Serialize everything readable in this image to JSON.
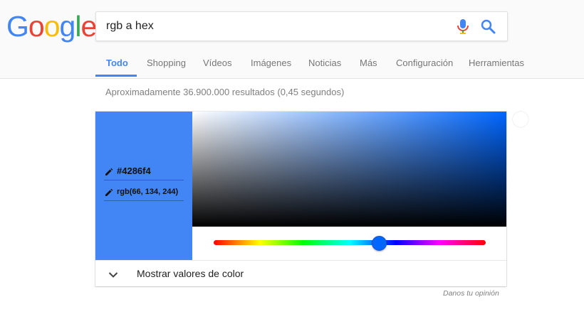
{
  "logo": {
    "letters": [
      "G",
      "o",
      "o",
      "g",
      "l",
      "e"
    ],
    "colors": [
      "#4285f4",
      "#ea4335",
      "#fbbc05",
      "#4285f4",
      "#34a853",
      "#ea4335"
    ]
  },
  "search": {
    "value": "rgb a hex",
    "mic_icon": "mic-icon",
    "search_icon": "search-icon"
  },
  "tabs": [
    {
      "label": "Todo",
      "active": true
    },
    {
      "label": "Shopping"
    },
    {
      "label": "Vídeos"
    },
    {
      "label": "Imágenes"
    },
    {
      "label": "Noticias"
    },
    {
      "label": "Más"
    },
    {
      "label": "Configuración"
    },
    {
      "label": "Herramientas"
    }
  ],
  "results_stats": "Aproximadamente 36.900.000 resultados (0,45 segundos)",
  "color_picker": {
    "hex": "#4286f4",
    "rgb": "rgb(66, 134, 244)",
    "swatch_color": "#4286f4",
    "hue_color": "#0066ff",
    "expand_label": "Mostrar valores de color"
  },
  "feedback_label": "Danos tu opinión",
  "accent": "#4285f4"
}
